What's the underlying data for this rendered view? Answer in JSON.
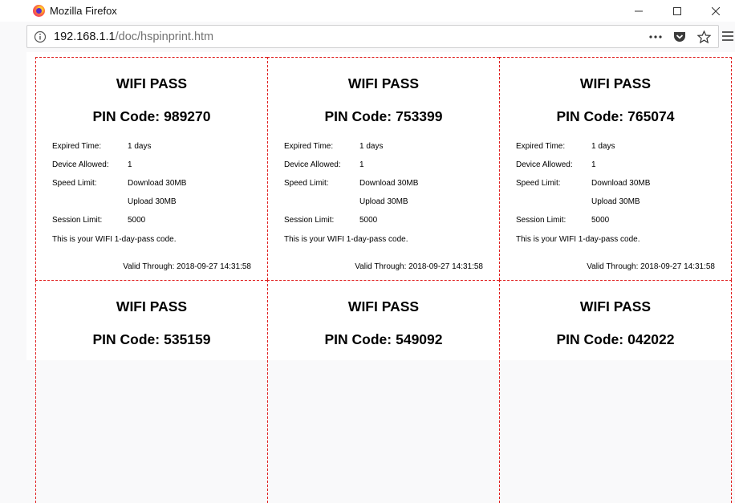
{
  "window": {
    "title": "Mozilla Firefox"
  },
  "urlbar": {
    "host": "192.168.1.1",
    "path": "/doc/hspinprint.htm"
  },
  "labels": {
    "expired": "Expired Time:",
    "device": "Device Allowed:",
    "speed": "Speed Limit:",
    "session": "Session Limit:"
  },
  "cards": [
    {
      "title": "WIFI PASS",
      "pin_label": "PIN Code:",
      "pin": "989270",
      "expired": "1 days",
      "device": "1",
      "download": "Download 30MB",
      "upload": "Upload 30MB",
      "session": "5000",
      "note": "This is your WIFI 1-day-pass code.",
      "valid_label": "Valid Through:",
      "valid": "2018-09-27 14:31:58"
    },
    {
      "title": "WIFI PASS",
      "pin_label": "PIN Code:",
      "pin": "753399",
      "expired": "1 days",
      "device": "1",
      "download": "Download 30MB",
      "upload": "Upload 30MB",
      "session": "5000",
      "note": "This is your WIFI 1-day-pass code.",
      "valid_label": "Valid Through:",
      "valid": "2018-09-27 14:31:58"
    },
    {
      "title": "WIFI PASS",
      "pin_label": "PIN Code:",
      "pin": "765074",
      "expired": "1 days",
      "device": "1",
      "download": "Download 30MB",
      "upload": "Upload 30MB",
      "session": "5000",
      "note": "This is your WIFI 1-day-pass code.",
      "valid_label": "Valid Through:",
      "valid": "2018-09-27 14:31:58"
    },
    {
      "title": "WIFI PASS",
      "pin_label": "PIN Code:",
      "pin": "535159"
    },
    {
      "title": "WIFI PASS",
      "pin_label": "PIN Code:",
      "pin": "549092"
    },
    {
      "title": "WIFI PASS",
      "pin_label": "PIN Code:",
      "pin": "042022"
    }
  ]
}
